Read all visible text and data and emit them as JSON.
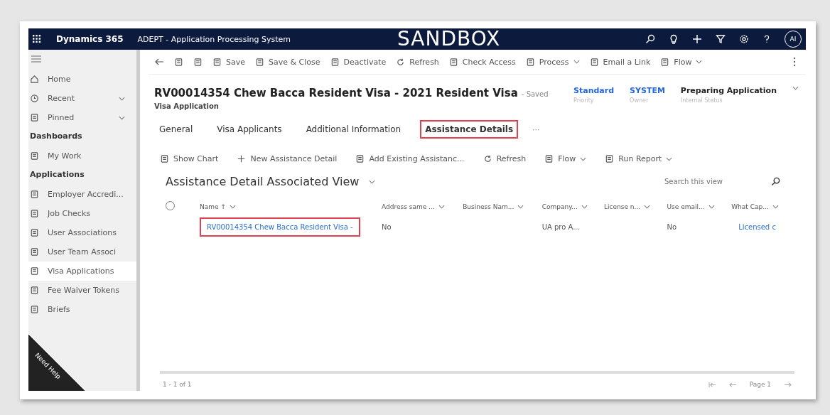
{
  "top_bar": {
    "app_name": "Dynamics 365",
    "system_name": "ADEPT - Application Processing System",
    "environment": "SANDBOX",
    "avatar": "AI"
  },
  "sidebar": {
    "items": [
      {
        "kind": "nav",
        "label": "Home",
        "selected": false,
        "expandable": false
      },
      {
        "kind": "nav",
        "label": "Recent",
        "selected": false,
        "expandable": true
      },
      {
        "kind": "nav",
        "label": "Pinned",
        "selected": false,
        "expandable": true
      },
      {
        "kind": "heading",
        "label": "Dashboards"
      },
      {
        "kind": "nav",
        "label": "My Work",
        "selected": false,
        "expandable": false
      },
      {
        "kind": "heading",
        "label": "Applications"
      },
      {
        "kind": "nav",
        "label": "Employer Accredi...",
        "selected": false,
        "expandable": false
      },
      {
        "kind": "nav",
        "label": "Job Checks",
        "selected": false,
        "expandable": false
      },
      {
        "kind": "nav",
        "label": "User Associations",
        "selected": false,
        "expandable": false
      },
      {
        "kind": "nav",
        "label": "User Team Associ",
        "selected": false,
        "expandable": false
      },
      {
        "kind": "nav",
        "label": "Visa Applications",
        "selected": true,
        "expandable": false
      },
      {
        "kind": "nav",
        "label": "Fee Waiver Tokens",
        "selected": false,
        "expandable": false
      },
      {
        "kind": "nav",
        "label": "Briefs",
        "selected": false,
        "expandable": false
      }
    ],
    "help_badge": "Need Help"
  },
  "command_bar": [
    "Save",
    "Save & Close",
    "Deactivate",
    "Refresh",
    "Check Access",
    "Process",
    "Email a Link",
    "Flow"
  ],
  "record": {
    "title": "RV00014354 Chew Bacca Resident Visa - 2021 Resident Visa",
    "save_state": "- Saved",
    "entity": "Visa Application",
    "fields": [
      {
        "value": "Standard",
        "label": "Priority",
        "kind": "link"
      },
      {
        "value": "SYSTEM",
        "label": "Owner",
        "kind": "link"
      },
      {
        "value": "Preparing Application",
        "label": "Internal Status",
        "kind": "text"
      }
    ]
  },
  "tabs": [
    {
      "label": "General",
      "selected": false,
      "highlighted": false
    },
    {
      "label": "Visa Applicants",
      "selected": false,
      "highlighted": false
    },
    {
      "label": "Additional Information",
      "selected": false,
      "highlighted": false
    },
    {
      "label": "Assistance Details",
      "selected": true,
      "highlighted": true
    }
  ],
  "tabs_more": "···",
  "subgrid": {
    "commands": [
      "Show Chart",
      "New Assistance Detail",
      "Add Existing Assistanc...",
      "Refresh",
      "Flow",
      "Run Report"
    ],
    "view_title": "Assistance Detail Associated View",
    "select_all": {
      "checked": false
    },
    "search": {
      "placeholder": "Search this view"
    },
    "columns": [
      "Name ↑",
      "Address same ...",
      "Business Nam...",
      "Company...",
      "License n...",
      "Use email...",
      "What Cap..."
    ],
    "rows": [
      {
        "selected": false,
        "highlighted": true,
        "cells": [
          "RV00014354 Chew Bacca Resident Visa -",
          "No",
          "",
          "UA pro A...",
          "",
          "No",
          "Licensed c"
        ]
      }
    ],
    "record_count": "1 - 1 of 1",
    "page": "Page 1"
  }
}
